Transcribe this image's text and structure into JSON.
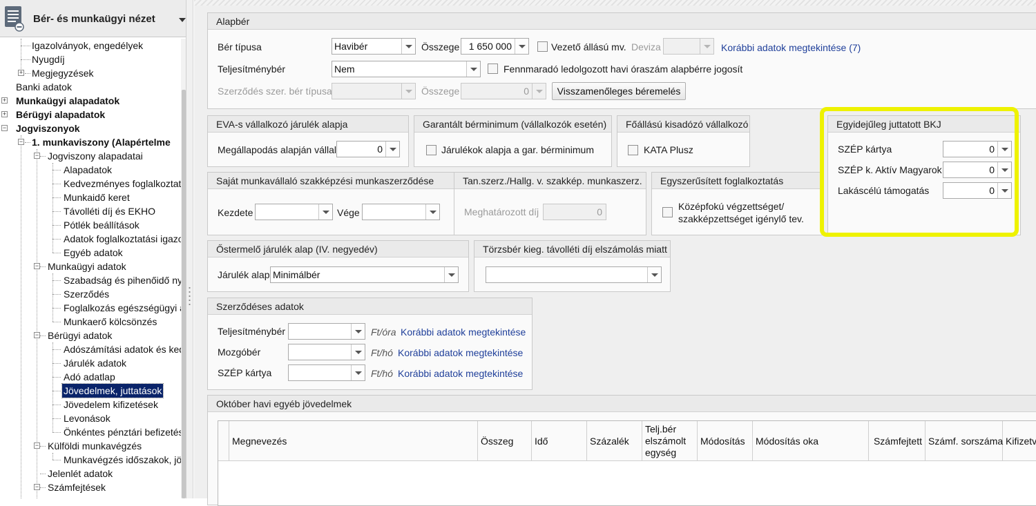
{
  "sidebar": {
    "title": "Bér- és munkaügyi nézet",
    "tree": [
      {
        "label": "Igazolványok, engedélyek"
      },
      {
        "label": "Nyugdíj"
      },
      {
        "label": "Megjegyzések"
      },
      {
        "label": "Banki adatok"
      },
      {
        "label": "Munkaügyi alapadatok"
      },
      {
        "label": "Bérügyi alapadatok"
      },
      {
        "label": "Jogviszonyok"
      },
      {
        "label": "1. munkaviszony  (Alapértelme"
      },
      {
        "label": "Jogviszony alapadatai"
      },
      {
        "label": "Alapadatok"
      },
      {
        "label": "Kedvezményes foglalkoztat"
      },
      {
        "label": "Munkaidő keret"
      },
      {
        "label": "Távolléti díj és EKHO"
      },
      {
        "label": "Pótlék beállítások"
      },
      {
        "label": "Adatok foglalkoztatási igazo"
      },
      {
        "label": "Egyéb adatok"
      },
      {
        "label": "Munkaügyi adatok"
      },
      {
        "label": "Szabadság és pihenőidő ny"
      },
      {
        "label": "Szerződés"
      },
      {
        "label": "Foglalkozás egészségügyi a"
      },
      {
        "label": "Munkaerő kölcsönzés"
      },
      {
        "label": "Bérügyi adatok"
      },
      {
        "label": "Adószámítási adatok és ked"
      },
      {
        "label": "Járulék adatok"
      },
      {
        "label": "Adó adatlap"
      },
      {
        "label": "Jövedelmek, juttatások"
      },
      {
        "label": "Jövedelem kifizetések"
      },
      {
        "label": "Levonások"
      },
      {
        "label": "Önkéntes pénztári befizetés"
      },
      {
        "label": "Külföldi munkavégzés"
      },
      {
        "label": "Munkavégzés időszakok, jö"
      },
      {
        "label": "Jelenlét adatok"
      },
      {
        "label": "Számfejtések"
      }
    ]
  },
  "alapber": {
    "title": "Alapbér",
    "ber_tipusa_label": "Bér típusa",
    "ber_tipusa_value": "Havibér",
    "osszege_label": "Összege",
    "osszege_value": "1 650 000",
    "vezeto_label": "Vezető állású mv.",
    "deviza_label": "Deviza",
    "korabbi_link": "Korábbi adatok megtekintése (7)",
    "teljesitmenyber_label": "Teljesítménybér",
    "teljesitmenyber_value": "Nem",
    "fennmarado_label": "Fennmaradó ledolgozott havi óraszám alapbérre jogosít",
    "szerzodes_label": "Szerződés szer. bér típusa",
    "osszege2_label": "Összege",
    "osszege2_value": "0",
    "visszamenoleges_button": "Visszamenőleges béremelés"
  },
  "eva": {
    "title": "EVA-s vállalkozó járulék alapja",
    "label": "Megállapodás alapján vállalt",
    "value": "0"
  },
  "garantalt": {
    "title": "Garantált bérminimum (vállalkozók esetén)",
    "checkbox_label": "Járulékok alapja a gar. bérminimum"
  },
  "fofoglalkozasu": {
    "title": "Főállású kisadózó vállalkozó",
    "checkbox_label": "KATA Plusz"
  },
  "bkj": {
    "title": "Egyidejűleg juttatott BKJ",
    "rows": [
      {
        "label": "SZÉP kártya",
        "value": "0"
      },
      {
        "label": "SZÉP k. Aktív Magyarok",
        "value": "0"
      },
      {
        "label": "Lakáscélú támogatás",
        "value": "0"
      }
    ]
  },
  "szakkepzes": {
    "title": "Saját munkavállaló szakképzési munkaszerződése",
    "kezdete_label": "Kezdete",
    "vege_label": "Vége"
  },
  "tanszerz": {
    "title": "Tan.szerz./Hallg. v. szakkép. munkaszerz.",
    "label": "Meghatározott díj",
    "value": "0"
  },
  "egyszerusitett": {
    "title": "Egyszerűsített foglalkoztatás",
    "checkbox_label_1": "Középfokú végzettséget/",
    "checkbox_label_2": "szakképzettséget igénylő tev."
  },
  "ostermelo": {
    "title": "Őstermelő járulék alap (IV. negyedév)",
    "label": "Járulék alap",
    "value": "Minimálbér"
  },
  "torzsber": {
    "title": "Törzsbér kieg. távolléti díj elszámolás miatt"
  },
  "szerzodeses": {
    "title": "Szerződéses adatok",
    "rows": [
      {
        "label": "Teljesítménybér",
        "unit": "Ft/óra",
        "link": "Korábbi adatok megtekintése"
      },
      {
        "label": "Mozgóbér",
        "unit": "Ft/hó",
        "link": "Korábbi adatok megtekintése"
      },
      {
        "label": "SZÉP kártya",
        "unit": "Ft/hó",
        "link": "Korábbi adatok megtekintése"
      }
    ]
  },
  "oktober": {
    "title": "Október havi egyéb jövedelmek",
    "columns": [
      "Megnevezés",
      "Összeg",
      "Idő",
      "Százalék",
      "Telj.bér\nelszámolt\negység",
      "Módosítás",
      "Módosítás oka",
      "Számfejtett",
      "Számf. sorszáma",
      "Kifizetve"
    ]
  },
  "colors": {
    "highlight": "#eef200",
    "selected": "#0a246a",
    "link": "#1f3f9a"
  }
}
